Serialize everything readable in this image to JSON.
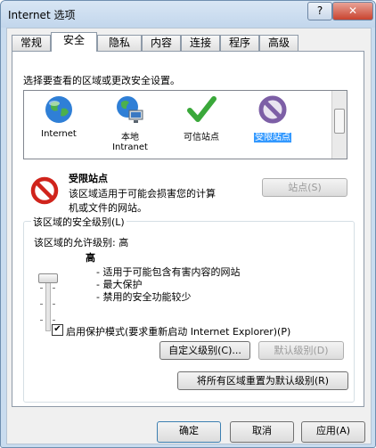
{
  "window": {
    "title": "Internet 选项",
    "help_label": "?",
    "close_label": "✕"
  },
  "tabs": [
    "常规",
    "安全",
    "隐私",
    "内容",
    "连接",
    "程序",
    "高级"
  ],
  "security": {
    "zone_prompt": "选择要查看的区域或更改安全设置。",
    "zones": [
      {
        "line1": "Internet",
        "line2": "",
        "icon": "globe-icon"
      },
      {
        "line1": "本地",
        "line2": "Intranet",
        "icon": "local-intranet-icon"
      },
      {
        "line1": "可信站点",
        "line2": "",
        "icon": "checkmark-icon"
      },
      {
        "line1": "受限站点",
        "line2": "",
        "icon": "restricted-icon"
      }
    ],
    "selected_zone_title": "受限站点",
    "selected_zone_desc_1": "该区域适用于可能会损害您的计算",
    "selected_zone_desc_2": "机或文件的网站。",
    "sites_button": "站点(S)",
    "level_group_label": "该区域的安全级别(L)",
    "allowed_levels_label": "该区域的允许级别: 高",
    "level_name": "高",
    "level_desc": [
      "- 适用于可能包含有害内容的网站",
      "- 最大保护",
      "- 禁用的安全功能较少"
    ],
    "protected_mode_label": "启用保护模式(要求重新启动 Internet Explorer)(P)",
    "protected_mode_check": "✔",
    "custom_level_button": "自定义级别(C)...",
    "default_level_button": "默认级别(D)",
    "reset_all_button": "将所有区域重置为默认级别(R)"
  },
  "footer": {
    "ok": "确定",
    "cancel": "取消",
    "apply": "应用(A)"
  }
}
